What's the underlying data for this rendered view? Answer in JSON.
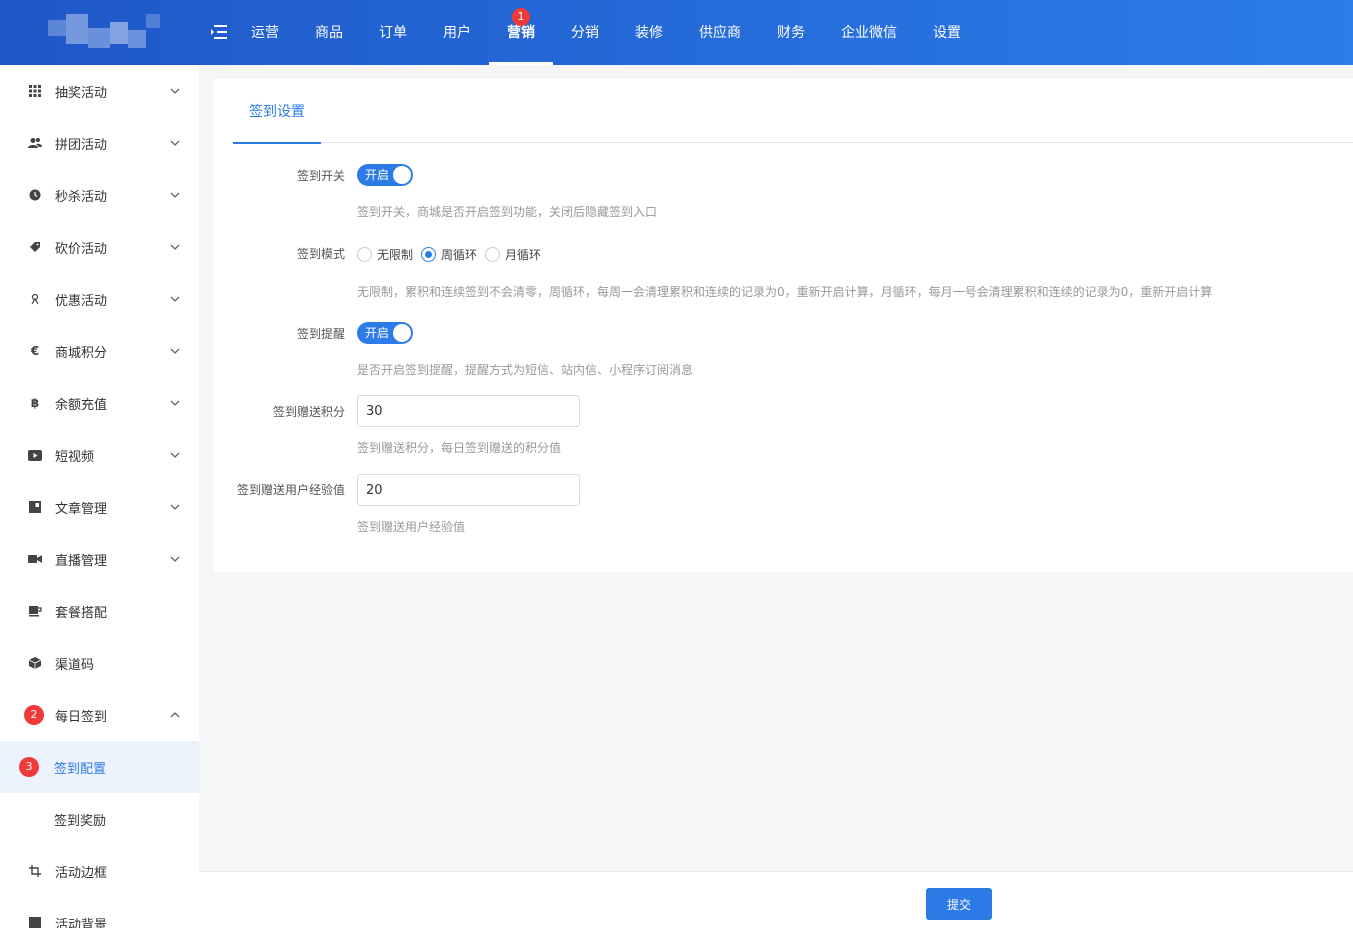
{
  "header": {
    "nav": [
      {
        "label": "运营"
      },
      {
        "label": "商品"
      },
      {
        "label": "订单"
      },
      {
        "label": "用户"
      },
      {
        "label": "营销",
        "active": true,
        "badge": "1"
      },
      {
        "label": "分销"
      },
      {
        "label": "装修"
      },
      {
        "label": "供应商"
      },
      {
        "label": "财务"
      },
      {
        "label": "企业微信"
      },
      {
        "label": "设置"
      }
    ]
  },
  "sidebar": {
    "items": [
      {
        "label": "抽奖活动",
        "icon": "grid-icon"
      },
      {
        "label": "拼团活动",
        "icon": "group-icon"
      },
      {
        "label": "秒杀活动",
        "icon": "clock-icon"
      },
      {
        "label": "砍价活动",
        "icon": "tag-icon"
      },
      {
        "label": "优惠活动",
        "icon": "gift-icon"
      },
      {
        "label": "商城积分",
        "icon": "euro-icon"
      },
      {
        "label": "余额充值",
        "icon": "bitcoin-icon"
      },
      {
        "label": "短视频",
        "icon": "video-play-icon"
      },
      {
        "label": "文章管理",
        "icon": "article-icon"
      },
      {
        "label": "直播管理",
        "icon": "camera-icon"
      },
      {
        "label": "套餐搭配",
        "icon": "cup-icon"
      },
      {
        "label": "渠道码",
        "icon": "cube-icon"
      },
      {
        "label": "每日签到",
        "badge": "2"
      },
      {
        "label": "签到配置",
        "badge": "3"
      },
      {
        "label": "签到奖励"
      },
      {
        "label": "活动边框",
        "icon": "crop-icon"
      },
      {
        "label": "活动背景",
        "icon": "image-icon"
      }
    ]
  },
  "panel": {
    "tab": "签到设置",
    "switch_label": "签到开关",
    "switch_text": "开启",
    "switch_hint": "签到开关，商城是否开启签到功能，关闭后隐藏签到入口",
    "mode_label": "签到模式",
    "mode_options": [
      "无限制",
      "周循环",
      "月循环"
    ],
    "mode_selected": "周循环",
    "mode_hint": "无限制，累积和连续签到不会清零，周循环，每周一会清理累积和连续的记录为0，重新开启计算，月循环，每月一号会清理累积和连续的记录为0，重新开启计算",
    "remind_label": "签到提醒",
    "remind_text": "开启",
    "remind_hint": "是否开启签到提醒，提醒方式为短信、站内信、小程序订阅消息",
    "points_label": "签到赠送积分",
    "points_value": "30",
    "points_hint": "签到赠送积分，每日签到赠送的积分值",
    "exp_label": "签到赠送用户经验值",
    "exp_value": "20",
    "exp_hint": "签到赠送用户经验值"
  },
  "footer": {
    "submit_label": "提交"
  }
}
